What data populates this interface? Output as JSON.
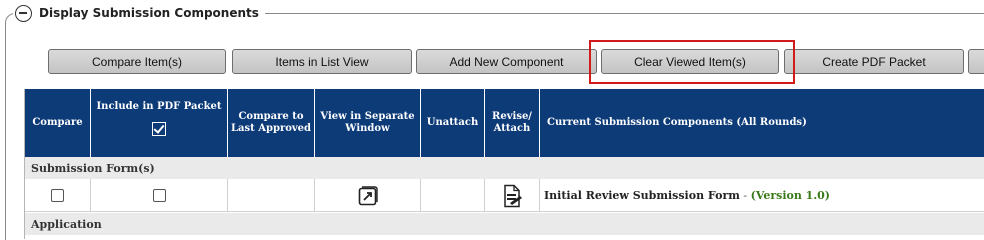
{
  "section": {
    "title": "Display Submission Components"
  },
  "toolbar": {
    "buttons": [
      {
        "label": "Compare Item(s)"
      },
      {
        "label": "Items in List View"
      },
      {
        "label": "Add New Component"
      },
      {
        "label": "Clear Viewed Item(s)"
      },
      {
        "label": "Create PDF Packet"
      },
      {
        "label": ""
      }
    ]
  },
  "table": {
    "headers": {
      "compare": "Compare",
      "include_pdf": "Include in PDF Packet",
      "compare_last": "Compare to Last Approved",
      "view_separate": "View in Separate Window",
      "unattach": "Unattach",
      "revise": "Revise/ Attach",
      "current": "Current Submission Components (All Rounds)"
    },
    "groups": [
      {
        "title": "Submission Form(s)",
        "rows": [
          {
            "name": "Initial Review Submission Form",
            "separator": " - ",
            "version": "(Version 1.0)"
          }
        ]
      },
      {
        "title": "Application"
      }
    ]
  },
  "icons": {
    "collapse": "collapse-icon",
    "check_all": "check-all-icon",
    "open_window": "external-window-icon",
    "revise_attach": "document-revise-icon"
  },
  "colors": {
    "header_bg": "#0d3b78",
    "highlight": "#d11a1a",
    "version_text": "#3a7a1a"
  }
}
